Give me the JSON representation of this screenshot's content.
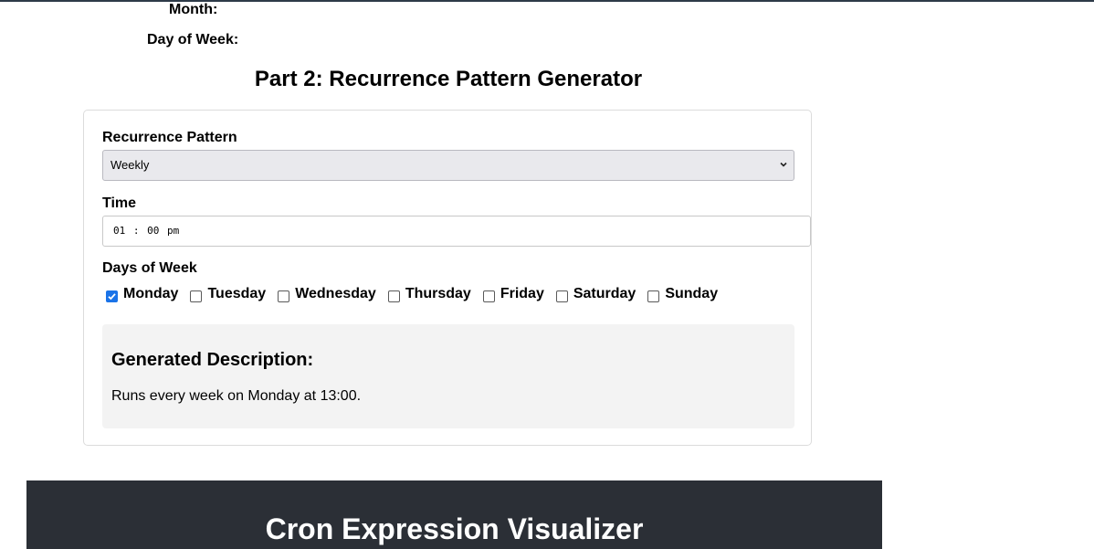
{
  "top_labels": {
    "month": "Month:",
    "day_of_week": "Day of Week:"
  },
  "part2": {
    "title": "Part 2: Recurrence Pattern Generator",
    "pattern_label": "Recurrence Pattern",
    "pattern_value": "Weekly",
    "time_label": "Time",
    "time_value": "01 : 00  pm",
    "days_label": "Days of Week",
    "days": [
      {
        "label": "Monday",
        "checked": true
      },
      {
        "label": "Tuesday",
        "checked": false
      },
      {
        "label": "Wednesday",
        "checked": false
      },
      {
        "label": "Thursday",
        "checked": false
      },
      {
        "label": "Friday",
        "checked": false
      },
      {
        "label": "Saturday",
        "checked": false
      },
      {
        "label": "Sunday",
        "checked": false
      }
    ],
    "description_title": "Generated Description:",
    "description_text": "Runs every week on Monday at 13:00."
  },
  "footer": {
    "title": "Cron Expression Visualizer"
  },
  "colors": {
    "checkbox_accent": "#1a73e8",
    "footer_bg": "#2b2f36"
  }
}
